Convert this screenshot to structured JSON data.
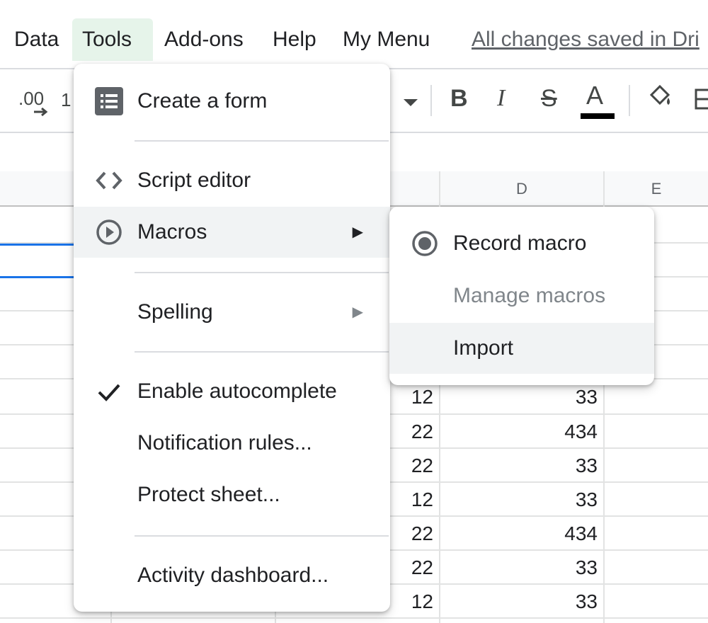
{
  "menubar": {
    "items": [
      {
        "label": "Data"
      },
      {
        "label": "Tools"
      },
      {
        "label": "Add-ons"
      },
      {
        "label": "Help"
      },
      {
        "label": "My Menu"
      }
    ],
    "save_status": "All changes saved in Dri"
  },
  "toolbar": {
    "decimal_label": ".00",
    "partial_label": "1",
    "bold": "B",
    "italic": "I",
    "strike": "S",
    "text_color": "A",
    "text_color_value": "#000000"
  },
  "grid": {
    "columns": [
      "D",
      "E"
    ],
    "rows": [
      {
        "c": "12",
        "d": "33"
      },
      {
        "c": "22",
        "d": "434"
      },
      {
        "c": "22",
        "d": "33"
      },
      {
        "c": "12",
        "d": "33"
      },
      {
        "c": "22",
        "d": "434"
      },
      {
        "c": "22",
        "d": "33"
      },
      {
        "c": "12",
        "d": "33"
      }
    ]
  },
  "tools_menu": {
    "items": [
      {
        "label": "Create a form",
        "icon": "form-icon"
      },
      {
        "label": "Script editor",
        "icon": "code-icon"
      },
      {
        "label": "Macros",
        "icon": "play-circle-icon",
        "submenu": true
      },
      {
        "label": "Spelling",
        "submenu": true
      },
      {
        "label": "Enable autocomplete",
        "icon": "check-icon",
        "checked": true
      },
      {
        "label": "Notification rules..."
      },
      {
        "label": "Protect sheet..."
      },
      {
        "label": "Activity dashboard..."
      }
    ]
  },
  "macros_submenu": {
    "items": [
      {
        "label": "Record macro",
        "icon": "record-icon"
      },
      {
        "label": "Manage macros",
        "disabled": true
      },
      {
        "label": "Import"
      }
    ]
  },
  "colors": {
    "active_menu_bg": "#e6f4ea",
    "selection_blue": "#1a73e8",
    "hover_bg": "#f1f3f4"
  }
}
